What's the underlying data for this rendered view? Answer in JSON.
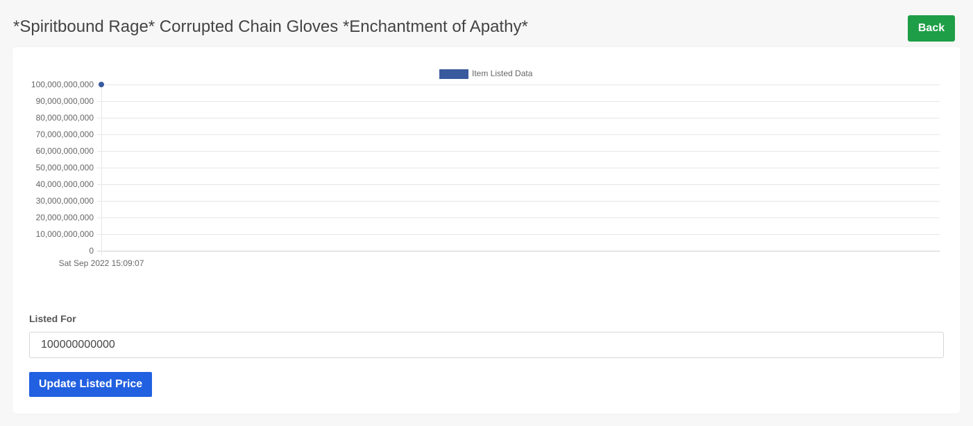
{
  "header": {
    "title": "*Spiritbound Rage* Corrupted Chain Gloves *Enchantment of Apathy*",
    "back_label": "Back"
  },
  "colors": {
    "back_button": "#1e9e47",
    "update_button": "#2160e0",
    "series": "#3a5a9e",
    "grid": "#e6e6e6",
    "axis_text": "#666666"
  },
  "chart_data": {
    "type": "line",
    "legend": [
      "Item Listed Data"
    ],
    "legend_position": "top-center",
    "grid": true,
    "x": [
      "Sat Sep 2022 15:09:07"
    ],
    "series": [
      {
        "name": "Item Listed Data",
        "values": [
          100000000000
        ]
      }
    ],
    "ylim": [
      0,
      100000000000
    ],
    "yticks": [
      "0",
      "10,000,000,000",
      "20,000,000,000",
      "30,000,000,000",
      "40,000,000,000",
      "50,000,000,000",
      "60,000,000,000",
      "70,000,000,000",
      "80,000,000,000",
      "90,000,000,000",
      "100,000,000,000"
    ]
  },
  "form": {
    "label": "Listed For",
    "value": "100000000000",
    "submit_label": "Update Listed Price"
  }
}
